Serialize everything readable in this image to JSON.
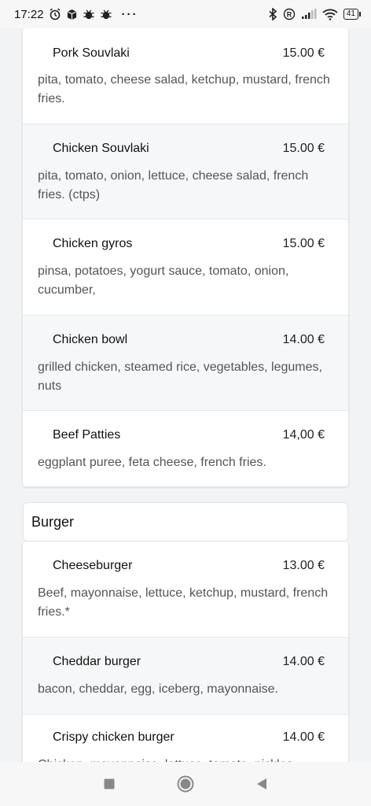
{
  "status_bar": {
    "time": "17:22",
    "battery": "41"
  },
  "sections": [
    {
      "items": [
        {
          "name": "Pork Souvlaki",
          "price": "15.00 €",
          "desc": "pita, tomato, cheese salad, ketchup, mustard, french fries."
        },
        {
          "name": "Chicken Souvlaki",
          "price": "15.00 €",
          "desc": "pita, tomato, onion, lettuce, cheese salad, french fries. (ctps)"
        },
        {
          "name": "Chicken gyros",
          "price": "15.00 €",
          "desc": "pinsa, potatoes, yogurt sauce, tomato, onion, cucumber,"
        },
        {
          "name": "Chicken bowl",
          "price": "14.00 €",
          "desc": "grilled chicken, steamed rice, vegetables, legumes, nuts"
        },
        {
          "name": "Beef Patties",
          "price": "14,00 €",
          "desc": "eggplant puree, feta cheese, french fries."
        }
      ]
    },
    {
      "title": "Burger",
      "items": [
        {
          "name": "Cheeseburger",
          "price": "13.00 €",
          "desc": "Beef, mayonnaise, lettuce, ketchup, mustard, french fries.*"
        },
        {
          "name": "Cheddar burger",
          "price": "14.00 €",
          "desc": "bacon, cheddar, egg, iceberg, mayonnaise."
        },
        {
          "name": "Crispy chicken burger",
          "price": "14.00 €",
          "desc": "Chicken, mayonnaise, lettuce, tomato, pickles"
        }
      ]
    }
  ]
}
